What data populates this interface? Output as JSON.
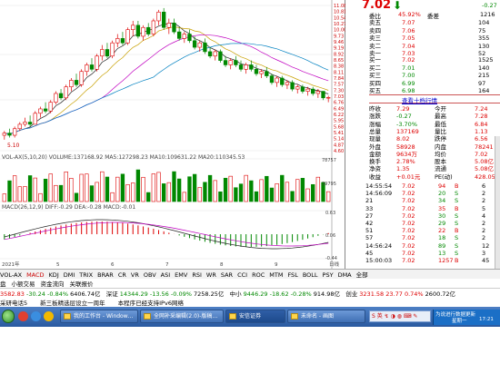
{
  "chart": {
    "price_axis": [
      "11.08",
      "10.81",
      "10.54",
      "10.27",
      "10.00",
      "9.73",
      "9.46",
      "9.19",
      "8.92",
      "8.65",
      "8.38",
      "8.11",
      "7.84",
      "7.57",
      "7.30",
      "7.03",
      "6.76",
      "6.49",
      "6.22",
      "5.95",
      "5.68",
      "5.41",
      "5.14",
      "4.87",
      "4.60"
    ],
    "candles": [
      {
        "o": 5.3,
        "h": 5.5,
        "l": 5.1,
        "c": 5.4
      },
      {
        "o": 5.4,
        "h": 5.6,
        "l": 5.2,
        "c": 5.3
      },
      {
        "o": 5.3,
        "h": 5.7,
        "l": 5.2,
        "c": 5.6
      },
      {
        "o": 5.6,
        "h": 5.9,
        "l": 5.5,
        "c": 5.8
      },
      {
        "o": 5.8,
        "h": 6.1,
        "l": 5.7,
        "c": 5.9
      },
      {
        "o": 5.9,
        "h": 6.2,
        "l": 5.7,
        "c": 5.8
      },
      {
        "o": 5.8,
        "h": 6.4,
        "l": 5.8,
        "c": 6.3
      },
      {
        "o": 6.3,
        "h": 6.6,
        "l": 6.1,
        "c": 6.5
      },
      {
        "o": 6.5,
        "h": 6.8,
        "l": 6.3,
        "c": 6.4
      },
      {
        "o": 6.4,
        "h": 6.9,
        "l": 6.3,
        "c": 6.8
      },
      {
        "o": 6.8,
        "h": 7.3,
        "l": 6.7,
        "c": 7.2
      },
      {
        "o": 7.2,
        "h": 7.4,
        "l": 6.9,
        "c": 7.0
      },
      {
        "o": 7.0,
        "h": 7.6,
        "l": 6.9,
        "c": 7.5
      },
      {
        "o": 7.5,
        "h": 7.9,
        "l": 7.3,
        "c": 7.8
      },
      {
        "o": 7.8,
        "h": 8.1,
        "l": 7.5,
        "c": 7.6
      },
      {
        "o": 7.6,
        "h": 8.3,
        "l": 7.5,
        "c": 8.2
      },
      {
        "o": 8.2,
        "h": 8.6,
        "l": 8.0,
        "c": 8.5
      },
      {
        "o": 8.5,
        "h": 8.8,
        "l": 8.2,
        "c": 8.3
      },
      {
        "o": 8.3,
        "h": 9.0,
        "l": 8.2,
        "c": 8.9
      },
      {
        "o": 8.9,
        "h": 9.4,
        "l": 8.7,
        "c": 9.2
      },
      {
        "o": 9.2,
        "h": 9.5,
        "l": 8.8,
        "c": 8.9
      },
      {
        "o": 8.9,
        "h": 9.6,
        "l": 8.8,
        "c": 9.5
      },
      {
        "o": 9.5,
        "h": 9.9,
        "l": 9.3,
        "c": 9.7
      },
      {
        "o": 9.7,
        "h": 10.0,
        "l": 9.4,
        "c": 9.5
      },
      {
        "o": 9.5,
        "h": 10.2,
        "l": 9.4,
        "c": 10.1
      },
      {
        "o": 10.1,
        "h": 10.5,
        "l": 9.8,
        "c": 10.3
      },
      {
        "o": 10.3,
        "h": 10.5,
        "l": 9.7,
        "c": 9.8
      },
      {
        "o": 9.8,
        "h": 10.3,
        "l": 9.6,
        "c": 10.2
      },
      {
        "o": 10.2,
        "h": 10.4,
        "l": 9.8,
        "c": 9.9
      },
      {
        "o": 9.9,
        "h": 10.6,
        "l": 9.8,
        "c": 10.5
      },
      {
        "o": 10.5,
        "h": 11.0,
        "l": 10.3,
        "c": 10.9
      },
      {
        "o": 10.9,
        "h": 11.08,
        "l": 10.1,
        "c": 10.2
      },
      {
        "o": 10.2,
        "h": 10.6,
        "l": 9.9,
        "c": 10.4
      },
      {
        "o": 10.4,
        "h": 10.6,
        "l": 9.9,
        "c": 10.0
      },
      {
        "o": 10.0,
        "h": 10.2,
        "l": 9.6,
        "c": 9.7
      },
      {
        "o": 9.7,
        "h": 10.0,
        "l": 9.5,
        "c": 9.9
      },
      {
        "o": 9.9,
        "h": 10.1,
        "l": 9.5,
        "c": 9.6
      },
      {
        "o": 9.6,
        "h": 9.8,
        "l": 9.2,
        "c": 9.3
      },
      {
        "o": 9.3,
        "h": 9.6,
        "l": 9.1,
        "c": 9.5
      },
      {
        "o": 9.5,
        "h": 9.7,
        "l": 9.0,
        "c": 9.1
      },
      {
        "o": 9.1,
        "h": 9.3,
        "l": 8.8,
        "c": 8.9
      },
      {
        "o": 8.9,
        "h": 9.2,
        "l": 8.7,
        "c": 9.1
      },
      {
        "o": 9.1,
        "h": 9.2,
        "l": 8.6,
        "c": 8.7
      },
      {
        "o": 8.7,
        "h": 8.9,
        "l": 8.4,
        "c": 8.5
      },
      {
        "o": 8.5,
        "h": 8.8,
        "l": 8.3,
        "c": 8.7
      },
      {
        "o": 8.7,
        "h": 8.9,
        "l": 8.4,
        "c": 8.5
      },
      {
        "o": 8.5,
        "h": 8.7,
        "l": 8.2,
        "c": 8.3
      },
      {
        "o": 8.3,
        "h": 8.6,
        "l": 8.1,
        "c": 8.5
      },
      {
        "o": 8.5,
        "h": 8.7,
        "l": 8.2,
        "c": 8.3
      },
      {
        "o": 8.3,
        "h": 8.5,
        "l": 8.0,
        "c": 8.1
      },
      {
        "o": 8.1,
        "h": 8.3,
        "l": 7.9,
        "c": 8.2
      },
      {
        "o": 8.2,
        "h": 8.4,
        "l": 7.9,
        "c": 8.0
      },
      {
        "o": 8.0,
        "h": 8.1,
        "l": 7.6,
        "c": 7.7
      },
      {
        "o": 7.7,
        "h": 8.0,
        "l": 7.5,
        "c": 7.9
      },
      {
        "o": 7.9,
        "h": 8.0,
        "l": 7.5,
        "c": 7.6
      },
      {
        "o": 7.6,
        "h": 7.8,
        "l": 7.4,
        "c": 7.7
      },
      {
        "o": 7.7,
        "h": 7.8,
        "l": 7.3,
        "c": 7.4
      },
      {
        "o": 7.4,
        "h": 7.6,
        "l": 7.2,
        "c": 7.5
      },
      {
        "o": 7.5,
        "h": 7.6,
        "l": 7.2,
        "c": 7.3
      },
      {
        "o": 7.3,
        "h": 7.5,
        "l": 7.1,
        "c": 7.4
      },
      {
        "o": 7.4,
        "h": 7.5,
        "l": 7.1,
        "c": 7.2
      },
      {
        "o": 7.2,
        "h": 7.4,
        "l": 7.0,
        "c": 7.3
      },
      {
        "o": 7.3,
        "h": 7.3,
        "l": 6.9,
        "c": 7.0
      },
      {
        "o": 7.0,
        "h": 7.1,
        "l": 6.8,
        "c": 7.02
      }
    ],
    "vol_label": "VOL-AX(5,10,20) VOLUME:137168.92 MA5:127298.23 MA10:109631.22 MA20:110345.53",
    "vol_axis": [
      "78757",
      "39795"
    ],
    "macd_label": "MACD(26,12,9) DIFF:-0.29 DEA:-0.28 MACD:-0.01",
    "macd_axis": [
      "0.63",
      "0.06",
      "-0.44"
    ],
    "date_labels": [
      "2021年",
      "5",
      "6",
      "7",
      "8",
      "9",
      "日线"
    ],
    "first_price_label": "5.10"
  },
  "right_panel": {
    "price": "7.02",
    "change_small": "-0.27",
    "volume_small": "1216",
    "weibi_label": "委比",
    "weibi_value": "45.92%",
    "weicha_label": "委差",
    "asks": [
      {
        "label": "卖五",
        "price": "7.07",
        "vol": "104"
      },
      {
        "label": "卖四",
        "price": "7.06",
        "vol": "75"
      },
      {
        "label": "卖三",
        "price": "7.05",
        "vol": "355"
      },
      {
        "label": "卖二",
        "price": "7.04",
        "vol": "130"
      },
      {
        "label": "卖一",
        "price": "7.03",
        "vol": "52"
      }
    ],
    "bids": [
      {
        "label": "买一",
        "price": "7.02",
        "vol": "1525"
      },
      {
        "label": "买二",
        "price": "7.01",
        "vol": "140"
      },
      {
        "label": "买三",
        "price": "7.00",
        "vol": "215"
      },
      {
        "label": "买四",
        "price": "6.99",
        "vol": "97"
      },
      {
        "label": "买五",
        "price": "6.98",
        "vol": "164"
      }
    ],
    "detail_link": "查看十档行情",
    "stats": [
      {
        "l1": "昨收",
        "v1": "7.29",
        "l2": "今开",
        "v2": "7.24"
      },
      {
        "l1": "涨跌",
        "v1": "-0.27",
        "l2": "最高",
        "v2": "7.28"
      },
      {
        "l1": "涨幅",
        "v1": "-3.70%",
        "l2": "最低",
        "v2": "6.84"
      },
      {
        "l1": "总量",
        "v1": "137169",
        "l2": "量比",
        "v2": "1.13"
      },
      {
        "l1": "现量",
        "v1": "8.02",
        "l2": "跌停",
        "v2": "6.56"
      },
      {
        "l1": "外盘",
        "v1": "58928",
        "l2": "内盘",
        "v2": "78241"
      },
      {
        "l1": "金额",
        "v1": "9634万",
        "l2": "均价",
        "v2": "7.02"
      },
      {
        "l1": "换手",
        "v1": "2.78%",
        "l2": "股本",
        "v2": "5.08亿"
      },
      {
        "l1": "净资",
        "v1": "1.35",
        "l2": "流通",
        "v2": "5.08亿"
      },
      {
        "l1": "收益",
        "v1": "+0.01元",
        "l2": "PE(动)",
        "v2": "428.05"
      }
    ],
    "ticks": [
      {
        "t": "14:55:54",
        "p": "7.02",
        "v": "94",
        "s": "B",
        "n": "6"
      },
      {
        "t": "14:56:09",
        "p": "7.02",
        "v": "20",
        "s": "S",
        "n": "2"
      },
      {
        "t": "21",
        "p": "7.02",
        "v": "34",
        "s": "S",
        "n": "2"
      },
      {
        "t": "33",
        "p": "7.02",
        "v": "35",
        "s": "B",
        "n": "5"
      },
      {
        "t": "27",
        "p": "7.02",
        "v": "30",
        "s": "S",
        "n": "4"
      },
      {
        "t": "42",
        "p": "7.02",
        "v": "29",
        "s": "S",
        "n": "2"
      },
      {
        "t": "51",
        "p": "7.02",
        "v": "22",
        "s": "B",
        "n": "2"
      },
      {
        "t": "57",
        "p": "7.02",
        "v": "18",
        "s": "S",
        "n": "2"
      },
      {
        "t": "14:56:24",
        "p": "7.02",
        "v": "89",
        "s": "S",
        "n": "12"
      },
      {
        "t": "45",
        "p": "7.02",
        "v": "13",
        "s": "S",
        "n": "3"
      },
      {
        "t": "15:00:03",
        "p": "7.02",
        "v": "1257",
        "s": "B",
        "n": "45"
      }
    ]
  },
  "indicator_tabs": [
    "VOL-AX",
    "MACD",
    "KDJ",
    "DMI",
    "TRIX",
    "BRAR",
    "CR",
    "VR",
    "OBV",
    "ASI",
    "EMV",
    "RSI",
    "WR",
    "SAR",
    "CCI",
    "ROC",
    "MTM",
    "FSL",
    "BOLL",
    "PSY",
    "DMA",
    "全部"
  ],
  "sub_tabs": [
    "盘",
    "小额交易",
    "资金流向",
    "关联报价"
  ],
  "ticker": {
    "a": "3582.83",
    "a_chg": "-30.24",
    "a_pct": "-0.84%",
    "a_amt": "6406.74亿",
    "sz_label": "深证",
    "sz": "14344.29",
    "sz_chg": "-13.56",
    "sz_pct": "-0.09%",
    "sz_amt": "7258.25亿",
    "zx_label": "中小",
    "zx": "9446.29",
    "zx_chg": "-18.62",
    "zx_pct": "-0.28%",
    "zx_amt": "914.98亿",
    "cy_label": "创业",
    "cy": "3231.58",
    "cy_chg": "23.77",
    "cy_pct": "0.74%",
    "cy_amt": "2600.72亿"
  },
  "news": [
    "采研电话5",
    "新三板精选层设立一周年",
    "本程序已经支持IPv6网络"
  ],
  "taskbar": {
    "apps": [
      "我的工作台 - Window…",
      "全网补采编辑(2.0)-版稿…",
      "安信证券",
      "未命名 - 画图"
    ],
    "tray_text": "为说进行数据更新",
    "time": "17:21",
    "weekday": "星期一"
  }
}
